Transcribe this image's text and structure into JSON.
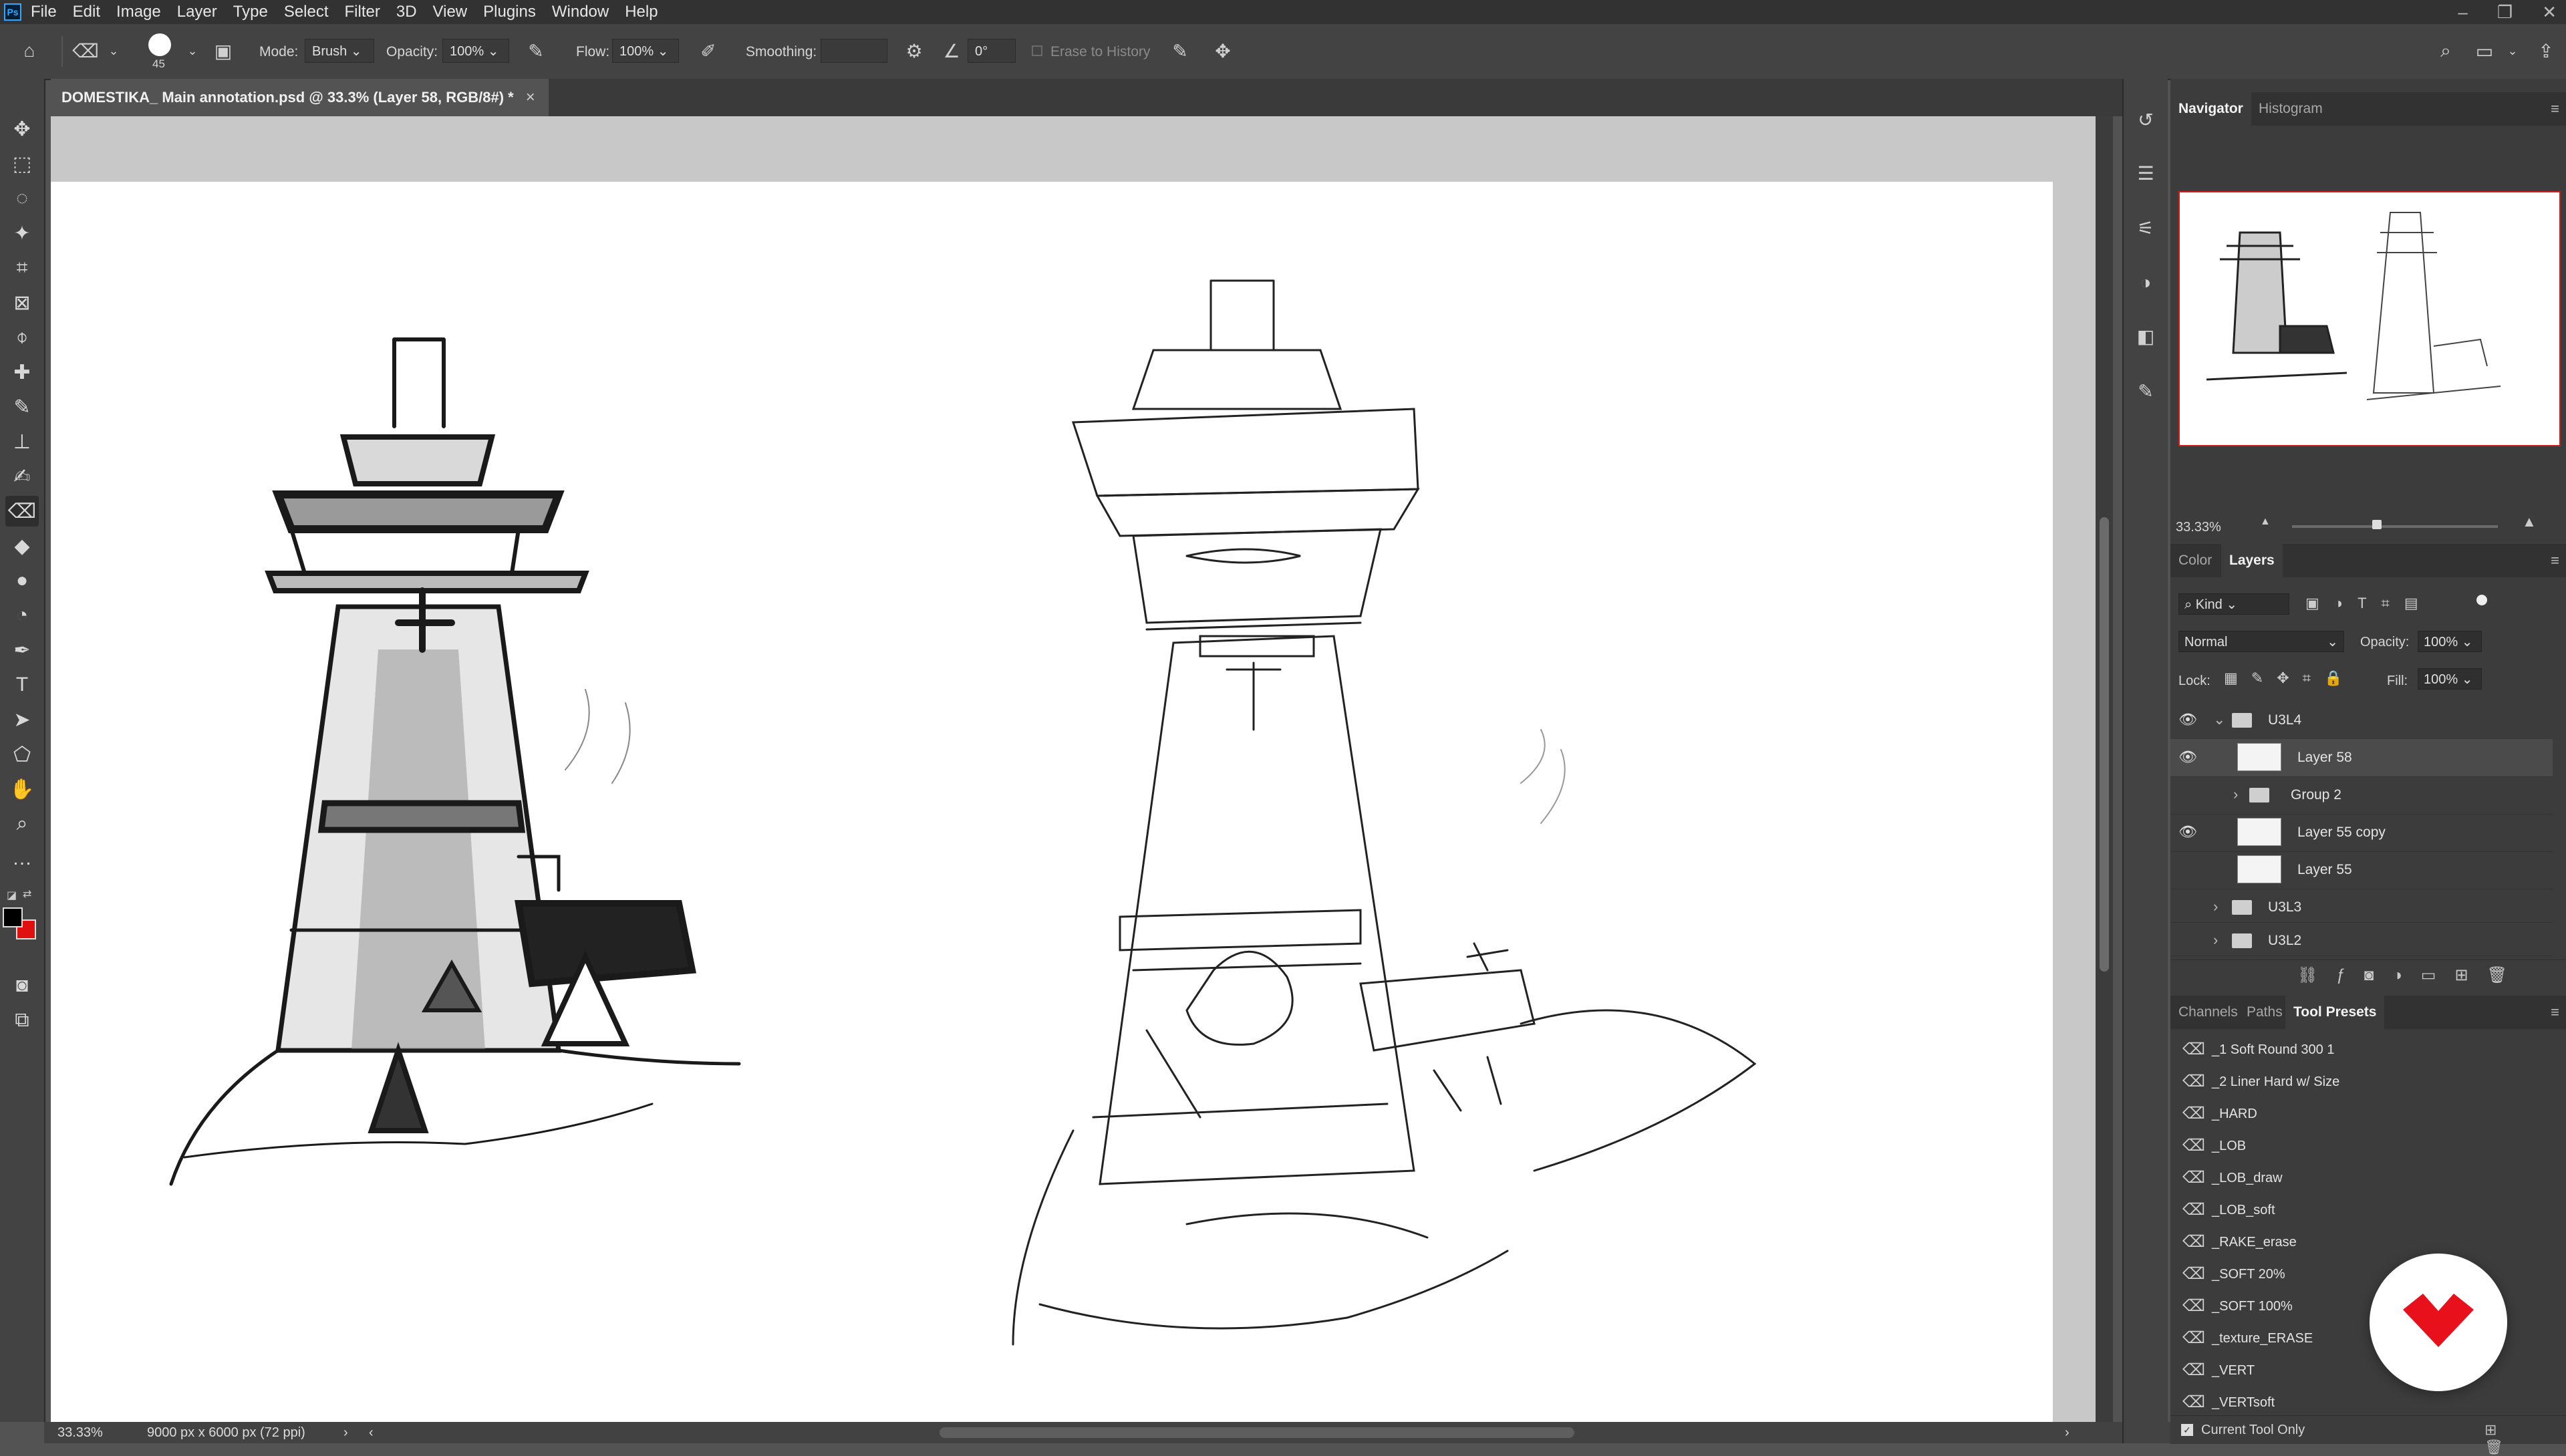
{
  "menubar": {
    "logo": "Ps",
    "items": [
      "File",
      "Edit",
      "Image",
      "Layer",
      "Type",
      "Select",
      "Filter",
      "3D",
      "View",
      "Plugins",
      "Window",
      "Help"
    ],
    "window_controls": [
      "–",
      "❐",
      "✕"
    ]
  },
  "options": {
    "brush_size": "45",
    "mode_label": "Mode:",
    "mode_value": "Brush",
    "opacity_label": "Opacity:",
    "opacity_value": "100%",
    "flow_label": "Flow:",
    "flow_value": "100%",
    "smoothing_label": "Smoothing:",
    "smoothing_value": "",
    "angle_value": "0°",
    "erase_history_label": "Erase to History"
  },
  "document": {
    "tab_title": "DOMESTIKA_ Main annotation.psd @ 33.3% (Layer 58, RGB/8#) *",
    "close": "×"
  },
  "status": {
    "zoom": "33.33%",
    "dimensions": "9000 px x 6000 px (72 ppi)",
    "arrow": "›",
    "left_arrow": "‹",
    "right_arrow": "›"
  },
  "navigator": {
    "tabs": [
      "Navigator",
      "Histogram"
    ],
    "zoom": "33.33%"
  },
  "layers_panel": {
    "tabs": [
      "Color",
      "Layers"
    ],
    "filter_kind": "Kind",
    "blend_mode": "Normal",
    "opacity_label": "Opacity:",
    "opacity_value": "100%",
    "lock_label": "Lock:",
    "fill_label": "Fill:",
    "fill_value": "100%",
    "layers": [
      {
        "name": "U3L4",
        "type": "group",
        "visible": true,
        "expanded": true,
        "indent": 0
      },
      {
        "name": "Layer 58",
        "type": "layer",
        "visible": true,
        "selected": true,
        "indent": 1
      },
      {
        "name": "Group 2",
        "type": "group",
        "visible": false,
        "expanded": false,
        "indent": 1
      },
      {
        "name": "Layer 55 copy",
        "type": "layer",
        "visible": true,
        "indent": 1
      },
      {
        "name": "Layer 55",
        "type": "layer",
        "visible": false,
        "indent": 1
      },
      {
        "name": "U3L3",
        "type": "group",
        "visible": false,
        "expanded": false,
        "indent": 0
      },
      {
        "name": "U3L2",
        "type": "group",
        "visible": false,
        "expanded": false,
        "indent": 0
      }
    ]
  },
  "tool_presets_panel": {
    "tabs": [
      "Channels",
      "Paths",
      "Tool Presets"
    ],
    "presets": [
      "_1 Soft Round 300 1",
      "_2 Liner Hard w/ Size",
      "_HARD",
      "_LOB",
      "_LOB_draw",
      "_LOB_soft",
      "_RAKE_erase",
      "_SOFT 20%",
      "_SOFT 100%",
      "_texture_ERASE",
      "_VERT",
      "_VERTsoft"
    ],
    "current_tool_only": "Current Tool Only"
  },
  "colors": {
    "foreground": "#000000",
    "background": "#e01010",
    "badge": "#e8101a"
  }
}
